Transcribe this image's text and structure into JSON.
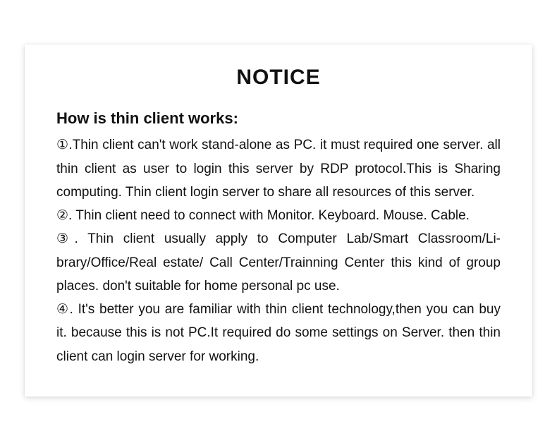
{
  "title": "NOTICE",
  "subtitle": "How is thin client works:",
  "items": [
    {
      "marker": "①",
      "text": ".Thin client can't work stand-alone as PC. it must required one server. all thin client as user to login this server by RDP protocol.This is Sharing computing. Thin client login server to share all resources of this server."
    },
    {
      "marker": "②",
      "text": ". Thin client need to connect with Monitor. Keyboard. Mouse. Cable."
    },
    {
      "marker": "③",
      "text": ". Thin client usually apply to Computer Lab/Smart Classroom/Li­brary/Office/Real estate/ Call Center/Trainning Center this kind of group places. don't suitable for home personal pc use."
    },
    {
      "marker": "④",
      "text": ". It's better you are familiar with thin client technology,then you can buy it. because this is not PC.It required do some settings on Server. then thin client can login server for working."
    }
  ]
}
